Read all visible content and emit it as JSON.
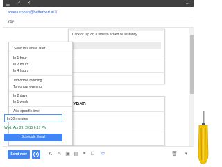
{
  "window": {
    "minimize_icon": "minimize-icon",
    "expand_icon": "expand-icon",
    "close_icon": "close-icon",
    "title": "..."
  },
  "compose": {
    "from_email": "ahana.cohen@betterbert.ai.il",
    "subject": "יופ'ג",
    "card_text": "Click or tap on a time to schedule instantly.",
    "card2_heading": "?האם"
  },
  "send_later": {
    "title": "Send this email later",
    "options_hours": [
      "In 1 hour",
      "In 2 hours",
      "In 4 hours"
    ],
    "options_day": [
      "Tomorrow morning",
      "Tomorrow evening"
    ],
    "options_days": [
      "In 2 days",
      "In 1 week"
    ],
    "specific_label": "At a specific time",
    "input_value": "In 30 minutes",
    "parsed_datetime": "Wed, Apr 29, 2015 6:17 PM",
    "schedule_button": "Schedule Email"
  },
  "toolbar": {
    "send_label": "Send now",
    "icons": [
      "text-color-icon",
      "attach-icon",
      "image-icon",
      "link-icon",
      "emoji-icon",
      "drive-icon",
      "wifi-icon",
      "trash-icon",
      "more-icon"
    ]
  },
  "colors": {
    "accent": "#4285f4",
    "link": "#3367d6",
    "date_green": "#0b8043",
    "titlebar": "#404040",
    "screwdriver_handle": "#f5c400"
  }
}
